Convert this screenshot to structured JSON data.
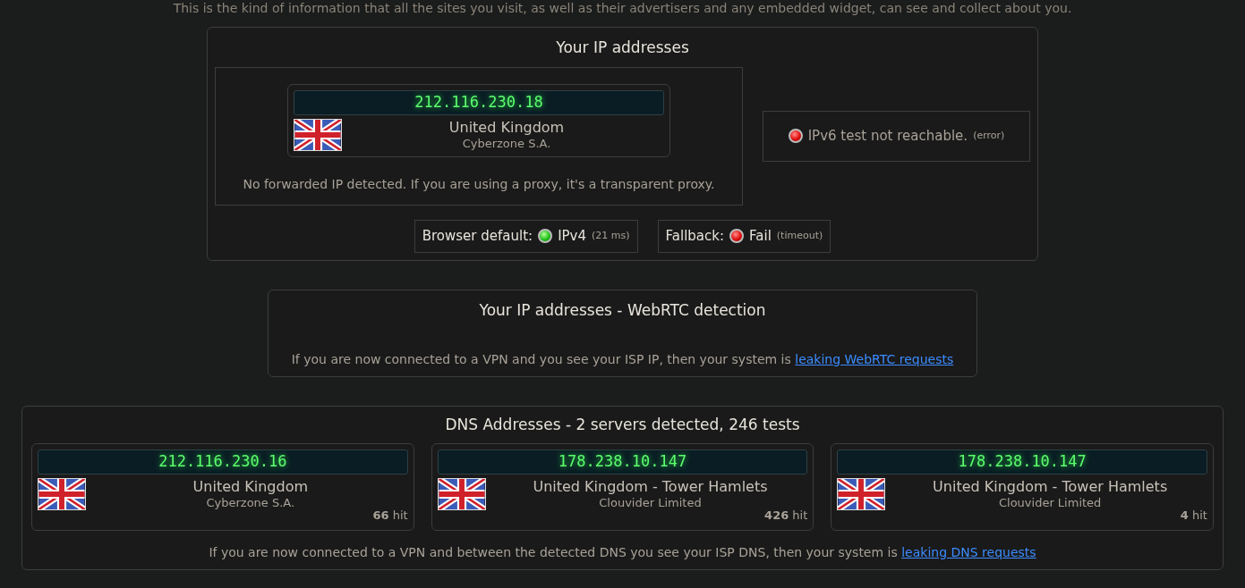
{
  "intro": "This is the kind of information that all the sites you visit, as well as their advertisers and any embedded widget, can see and collect about you.",
  "ip_panel": {
    "title": "Your IP addresses",
    "ipv4": {
      "ip": "212.116.230.18",
      "country": "United Kingdom",
      "isp": "Cyberzone S.A."
    },
    "forwarded_note": "No forwarded IP detected. If you are using a proxy, it's a transparent proxy.",
    "ipv6": {
      "ok": false,
      "message": "IPv6 test not reachable.",
      "detail": "(error)"
    },
    "tests": [
      {
        "label": "Browser default:",
        "ok": true,
        "value": "IPv4",
        "detail": "(21 ms)"
      },
      {
        "label": "Fallback:",
        "ok": false,
        "value": "Fail",
        "detail": "(timeout)"
      }
    ]
  },
  "webrtc_panel": {
    "title": "Your IP addresses - WebRTC detection",
    "notice": "If you are now connected to a VPN and you see your ISP IP, then your system is",
    "link": "leaking WebRTC requests"
  },
  "dns_panel": {
    "title": "DNS Addresses - 2 servers detected, 246 tests",
    "servers": [
      {
        "ip": "212.116.230.16",
        "location": "United Kingdom",
        "isp": "Cyberzone S.A.",
        "hits": "**66** hit"
      },
      {
        "ip": "178.238.10.147",
        "location": "United Kingdom - Tower Hamlets",
        "isp": "Clouvider Limited",
        "hits": "**426** hit"
      },
      {
        "ip": "178.238.10.147",
        "location": "United Kingdom - Tower Hamlets",
        "isp": "Clouvider Limited",
        "hits": "**4** hit"
      }
    ],
    "notice": "If you are now connected to a VPN and between the detected DNS you see your ISP DNS, then your system is",
    "link": "leaking DNS requests"
  }
}
